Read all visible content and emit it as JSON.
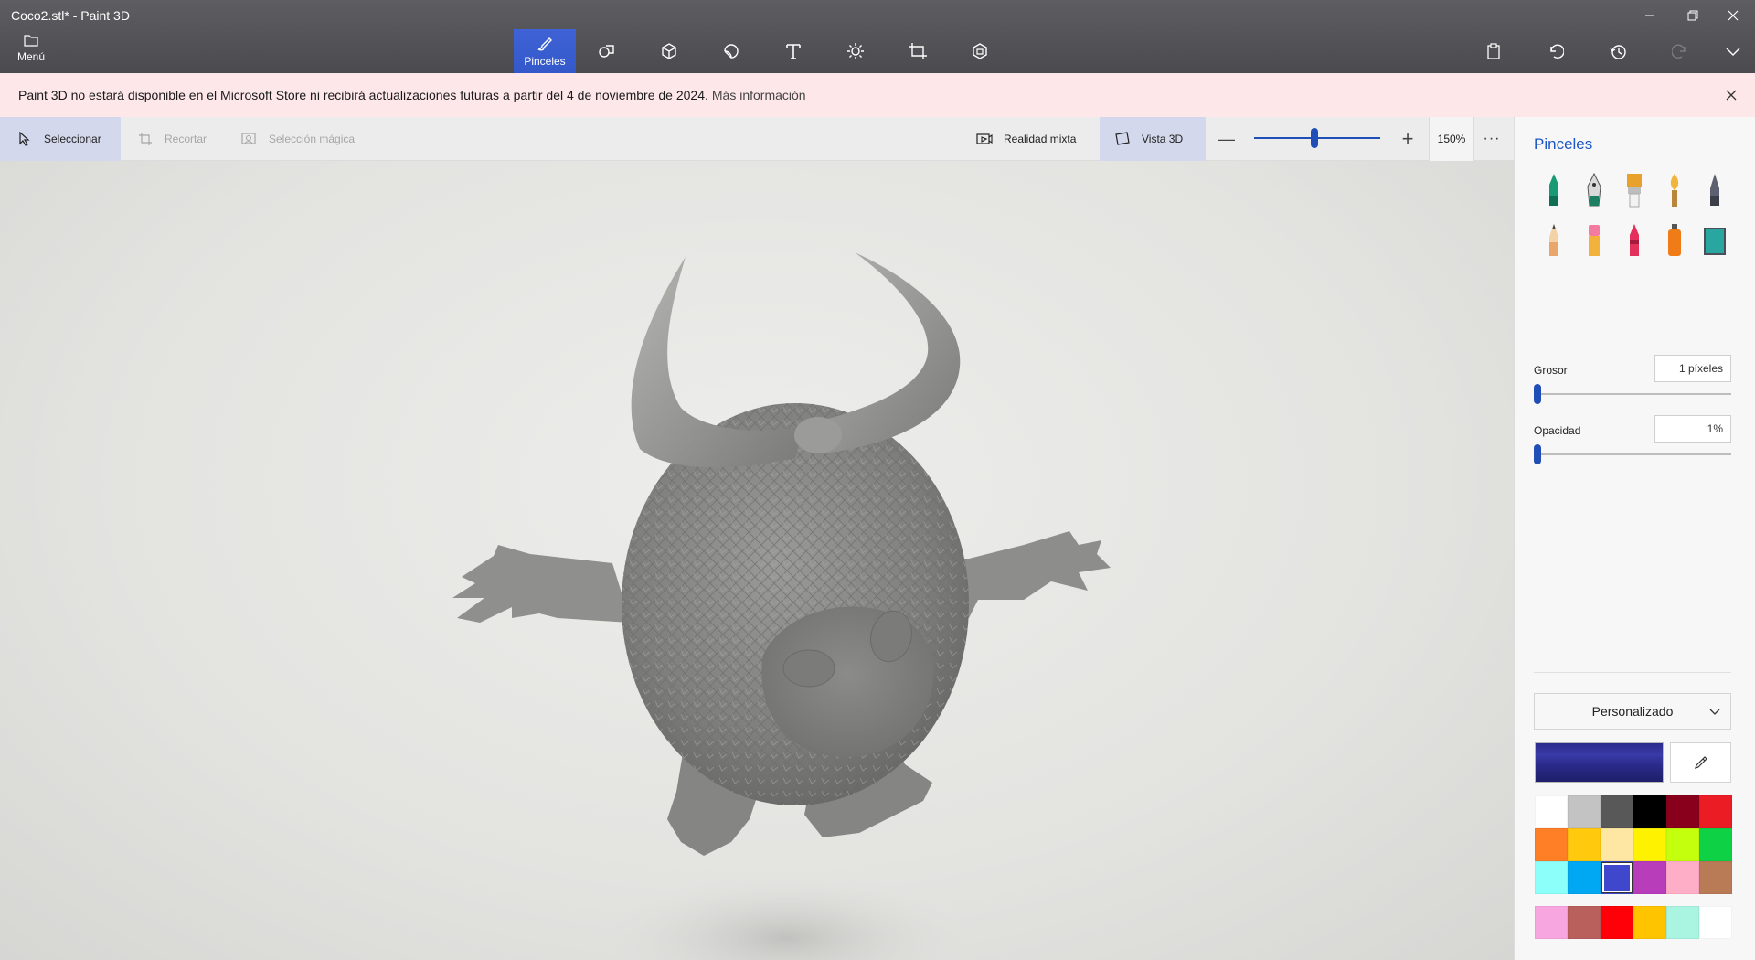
{
  "window": {
    "title": "Coco2.stl* - Paint 3D",
    "controls": {
      "minimize": "—",
      "restore": "❐",
      "close": "✕"
    }
  },
  "ribbon": {
    "menu_label": "Menú",
    "tools": [
      {
        "name": "brushes",
        "label": "Pinceles",
        "icon": "brush-icon",
        "active": true
      },
      {
        "name": "2d-shapes",
        "label": "",
        "icon": "shapes-2d-icon"
      },
      {
        "name": "3d-shapes",
        "label": "",
        "icon": "cube-icon"
      },
      {
        "name": "stickers",
        "label": "",
        "icon": "sticker-icon"
      },
      {
        "name": "text",
        "label": "",
        "icon": "text-icon"
      },
      {
        "name": "effects",
        "label": "",
        "icon": "sun-icon"
      },
      {
        "name": "canvas",
        "label": "",
        "icon": "canvas-crop-icon"
      },
      {
        "name": "3d-library",
        "label": "",
        "icon": "library-icon"
      }
    ],
    "right_tools": [
      "paste-icon",
      "undo-icon",
      "history-icon",
      "redo-icon",
      "expand-icon"
    ]
  },
  "notice": {
    "text": "Paint 3D no estará disponible en el Microsoft Store ni recibirá actualizaciones futuras a partir del 4 de noviembre de 2024.",
    "link": "Más información",
    "close": "✕"
  },
  "subbar": {
    "select": "Seleccionar",
    "crop": "Recortar",
    "magic_select": "Selección mágica",
    "mixed_reality": "Realidad mixta",
    "view_3d": "Vista 3D",
    "zoom_value": "150%",
    "zoom_fraction": 0.48,
    "zoom_minus": "—",
    "zoom_plus": "+",
    "more": "···"
  },
  "panel": {
    "title": "Pinceles",
    "brushes": [
      {
        "name": "marker",
        "color": "#1a9a74"
      },
      {
        "name": "calligraphy-pen",
        "color": "#1c7f62"
      },
      {
        "name": "oil-brush",
        "color": "#e8a12a"
      },
      {
        "name": "watercolor",
        "color": "#f1b53c"
      },
      {
        "name": "pixel-pen",
        "color": "#5d6070"
      },
      {
        "name": "pencil",
        "color": "#e9a66b"
      },
      {
        "name": "eraser",
        "color": "#f57aa0"
      },
      {
        "name": "crayon",
        "color": "#e4315b"
      },
      {
        "name": "spray-can",
        "color": "#f07c18"
      },
      {
        "name": "fill",
        "color": "#2aa6a0"
      }
    ],
    "thickness_label": "Grosor",
    "thickness_value": "1 píxeles",
    "thickness_fraction": 0.0,
    "opacity_label": "Opacidad",
    "opacity_value": "1%",
    "opacity_fraction": 0.0,
    "palette_label": "Personalizado",
    "current_color": "#2b2b8c",
    "swatches": [
      "#ffffff",
      "#c3c3c3",
      "#585858",
      "#000000",
      "#88001b",
      "#ec1c24",
      "#ff7f27",
      "#ffc90e",
      "#fde7a2",
      "#fff200",
      "#c4ff0e",
      "#0ed145",
      "#8cfffb",
      "#00a8f3",
      "#3f48cc",
      "#b83dba",
      "#ffaec8",
      "#b97a56"
    ],
    "selected_swatch": 14,
    "custom_swatches": [
      "#f7a6e0",
      "#b95f5c",
      "#ff0008",
      "#ffc400",
      "#a9f5e1",
      "#ffffff"
    ]
  }
}
